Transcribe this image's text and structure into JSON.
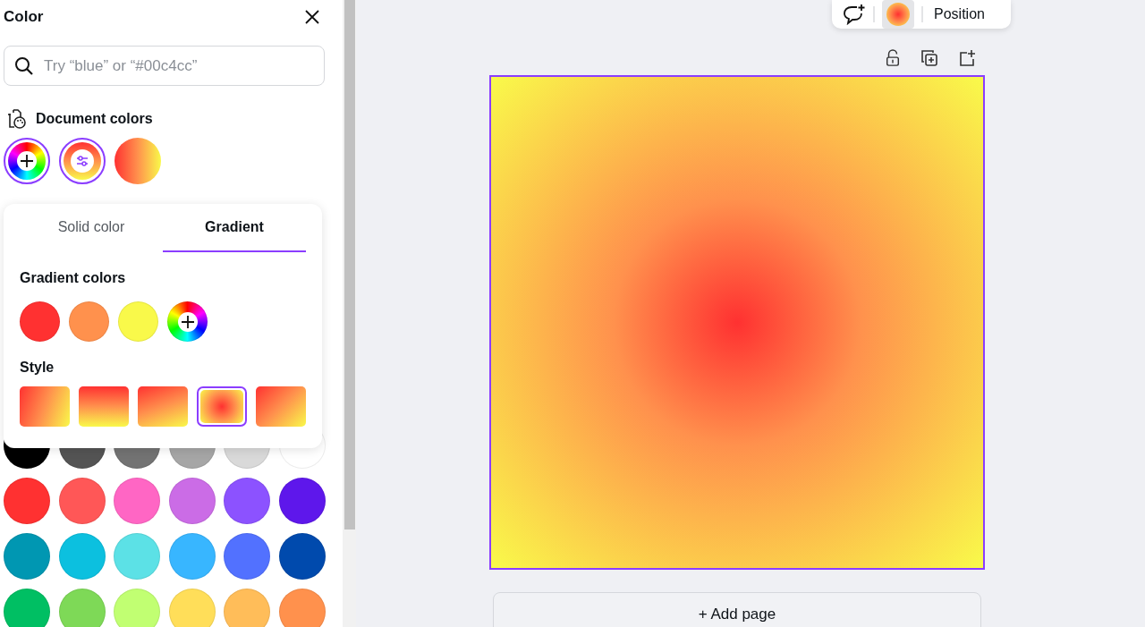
{
  "panel": {
    "title": "Color",
    "search": {
      "placeholder": "Try “blue” or “#00c4cc”"
    },
    "document_colors": {
      "heading": "Document colors",
      "items": [
        {
          "kind": "add",
          "selected": true
        },
        {
          "kind": "edit",
          "selected": true
        },
        {
          "kind": "gradient",
          "selected": false
        }
      ]
    },
    "palette": [
      [
        {
          "color": "#000000"
        },
        {
          "color": "#545454"
        },
        {
          "color": "#737373"
        },
        {
          "color": "#a6a6a6"
        },
        {
          "color": "#d9d9d9"
        },
        {
          "color": "#ffffff"
        }
      ],
      [
        {
          "color": "#ff3131"
        },
        {
          "color": "#ff5757"
        },
        {
          "color": "#ff66c4"
        },
        {
          "color": "#cb6ce6"
        },
        {
          "color": "#8c52ff"
        },
        {
          "color": "#5e17eb"
        }
      ],
      [
        {
          "color": "#0097b2"
        },
        {
          "color": "#0cc0df"
        },
        {
          "color": "#5ce1e6"
        },
        {
          "color": "#38b6ff"
        },
        {
          "color": "#5271ff"
        },
        {
          "color": "#004aad"
        }
      ],
      [
        {
          "color": "#00bf63"
        },
        {
          "color": "#7ed957"
        },
        {
          "color": "#c1ff72"
        },
        {
          "color": "#ffde59"
        },
        {
          "color": "#ffbd59"
        },
        {
          "color": "#ff914d"
        }
      ]
    ]
  },
  "popover": {
    "tabs": [
      {
        "label": "Solid color",
        "selected": false
      },
      {
        "label": "Gradient",
        "selected": true
      }
    ],
    "gradient_colors": {
      "heading": "Gradient colors",
      "items": [
        {
          "kind": "color",
          "color": "#ff3131"
        },
        {
          "kind": "color",
          "color": "#ff914d"
        },
        {
          "kind": "color",
          "color": "#f9f94a"
        },
        {
          "kind": "add"
        }
      ]
    },
    "style": {
      "heading": "Style",
      "items": [
        {
          "kind": "diagonal",
          "selected": false
        },
        {
          "kind": "vertical",
          "selected": false
        },
        {
          "kind": "diagonal-reverse",
          "selected": false
        },
        {
          "kind": "radial",
          "selected": true
        },
        {
          "kind": "diagonal-corner",
          "selected": false
        }
      ]
    }
  },
  "toolbar": {
    "items": [
      {
        "kind": "comment"
      },
      {
        "kind": "color"
      },
      {
        "kind": "text",
        "label": "Position"
      }
    ]
  },
  "page_actions": [
    {
      "kind": "lock"
    },
    {
      "kind": "duplicate"
    },
    {
      "kind": "add"
    }
  ],
  "add_page": {
    "label": "+ Add page"
  }
}
